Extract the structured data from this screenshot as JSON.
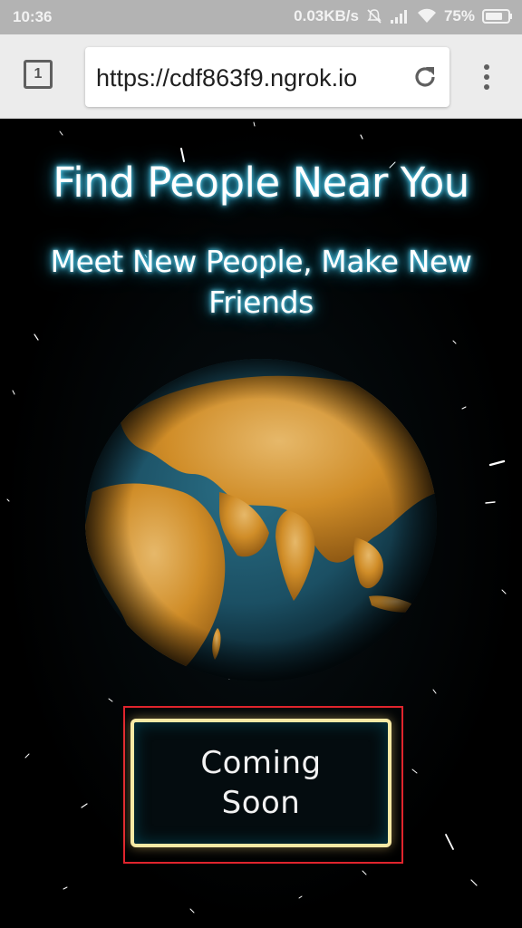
{
  "status_bar": {
    "time": "10:36",
    "network_speed": "0.03KB/s",
    "battery_percent": "75%",
    "icons": [
      "mute-icon",
      "signal-icon",
      "wifi-icon",
      "battery-icon"
    ]
  },
  "browser": {
    "tab_count": "1",
    "url": "https://cdf863f9.ngrok.io",
    "icons": [
      "reload-icon",
      "menu-icon"
    ]
  },
  "page": {
    "headline": "Find People Near You",
    "subheadline": "Meet New People, Make New Friends",
    "cta_label": "Coming Soon"
  },
  "colors": {
    "page_background": "#000000",
    "title_glow": "#45d6ff",
    "button_border": "#f7e9a4",
    "highlight_box": "#e0242d",
    "status_bar": "#b3b3b3",
    "toolbar": "#ececec"
  }
}
